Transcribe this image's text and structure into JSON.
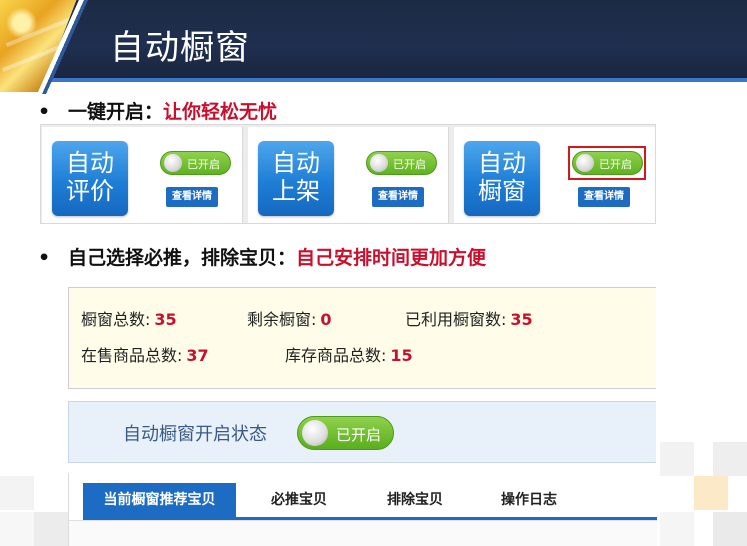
{
  "header": {
    "title": "自动橱窗"
  },
  "bullets": [
    {
      "text": "一键开启：",
      "highlight": "让你轻松无忧"
    },
    {
      "text": "自己选择必推，排除宝贝：",
      "highlight": "自己安排时间更加方便"
    }
  ],
  "feature_cards": [
    {
      "tile_line1": "自动",
      "tile_line2": "评价",
      "toggle": "已开启",
      "detail_button": "查看详情"
    },
    {
      "tile_line1": "自动",
      "tile_line2": "上架",
      "toggle": "已开启",
      "detail_button": "查看详情"
    },
    {
      "tile_line1": "自动",
      "tile_line2": "橱窗",
      "toggle": "已开启",
      "detail_button": "查看详情"
    }
  ],
  "stats": {
    "window_total_label": "橱窗总数:",
    "window_total": "35",
    "window_remaining_label": "剩余橱窗:",
    "window_remaining": "0",
    "window_used_label": "已利用橱窗数:",
    "window_used": "35",
    "on_sale_label": "在售商品总数:",
    "on_sale": "37",
    "inventory_label": "库存商品总数:",
    "inventory": "15"
  },
  "status": {
    "label": "自动橱窗开启状态",
    "toggle": "已开启"
  },
  "tabs": [
    {
      "label": "当前橱窗推荐宝贝",
      "active": true
    },
    {
      "label": "必推宝贝",
      "active": false
    },
    {
      "label": "排除宝贝",
      "active": false
    },
    {
      "label": "操作日志",
      "active": false
    }
  ],
  "colors": {
    "accent_blue": "#1c6cc3",
    "highlight_red": "#c8102e",
    "toggle_green": "#5fb320",
    "header_navy": "#1f2f4f"
  }
}
